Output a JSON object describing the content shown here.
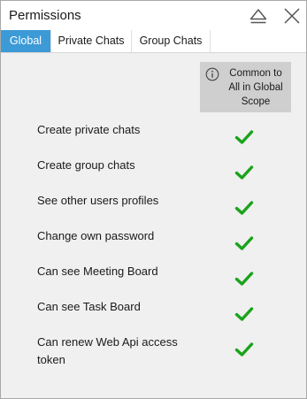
{
  "window": {
    "title": "Permissions",
    "eject_icon": "eject-icon",
    "close_icon": "close-icon"
  },
  "tabs": [
    {
      "label": "Global",
      "active": true
    },
    {
      "label": "Private Chats",
      "active": false
    },
    {
      "label": "Group Chats",
      "active": false
    }
  ],
  "scope_header": {
    "icon": "info-icon",
    "text": "Common to\nAll in Global\nScope"
  },
  "permissions": [
    {
      "label": "Create private chats",
      "granted": true
    },
    {
      "label": "Create group chats",
      "granted": true
    },
    {
      "label": "See other users profiles",
      "granted": true
    },
    {
      "label": "Change own password",
      "granted": true
    },
    {
      "label": "Can see Meeting Board",
      "granted": true
    },
    {
      "label": "Can see Task Board",
      "granted": true
    },
    {
      "label": "Can renew Web Api access token",
      "granted": true
    }
  ],
  "colors": {
    "accent": "#3c9ad6",
    "check": "#1aa31a",
    "scope_header_bg": "#cfcfcf",
    "panel_bg": "#f0f0f0"
  }
}
